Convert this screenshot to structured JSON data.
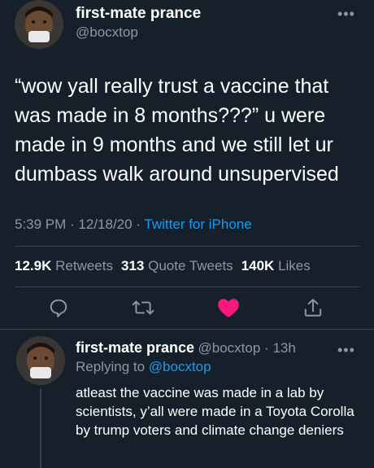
{
  "tweet": {
    "display_name": "first-mate prance",
    "handle": "@bocxtop",
    "text": "“wow yall really trust a vaccine that was made in 8 months???” u were made in 9 months and we still let ur dumbass walk around unsupervised",
    "time": "5:39 PM",
    "date": "12/18/20",
    "source": "Twitter for iPhone",
    "retweets_count": "12.9K",
    "retweets_label": "Retweets",
    "quotes_count": "313",
    "quotes_label": "Quote Tweets",
    "likes_count": "140K",
    "likes_label": "Likes"
  },
  "reply": {
    "display_name": "first-mate prance",
    "handle": "@bocxtop",
    "age": "13h",
    "replying_to_label": "Replying to",
    "replying_to_handle": "@bocxtop",
    "text": "atleast the vaccine was made in a lab by scientists, y’all were made in a Toyota Corolla by trump voters and climate change deniers"
  },
  "icons": {
    "reply": "reply-icon",
    "retweet": "retweet-icon",
    "like": "heart-icon",
    "share": "share-icon",
    "more": "more-icon"
  },
  "colors": {
    "background": "#15202b",
    "accent": "#1d9bf0",
    "secondary_text": "#8b98a5",
    "liked": "#f91880",
    "divider": "#38444d"
  }
}
